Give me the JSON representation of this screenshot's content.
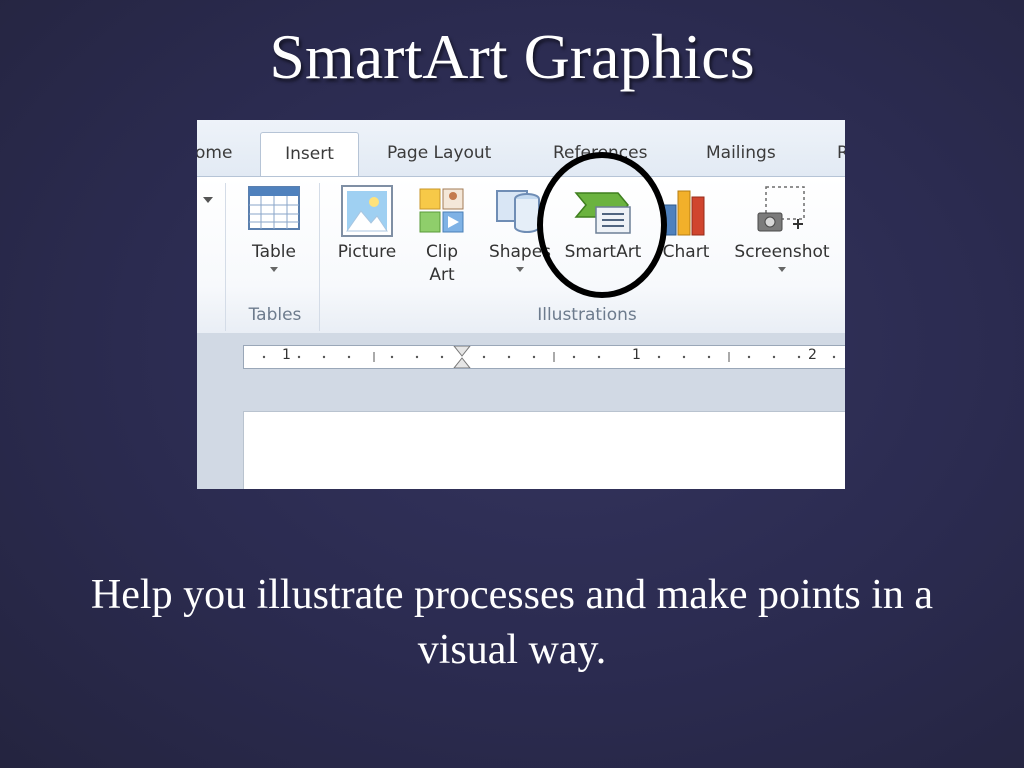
{
  "slide": {
    "title": "SmartArt Graphics",
    "body": "Help you illustrate processes and make points in a visual way."
  },
  "ribbon": {
    "tabs": {
      "home_partial": "ome",
      "insert": "Insert",
      "page_layout": "Page Layout",
      "references": "References",
      "mailings": "Mailings",
      "next_partial": "R"
    },
    "active_tab": "Insert",
    "buttons": {
      "table": "Table",
      "picture": "Picture",
      "clip_art_line1": "Clip",
      "clip_art_line2": "Art",
      "shapes": "Shapes",
      "smartart": "SmartArt",
      "chart": "Chart",
      "screenshot": "Screenshot"
    },
    "groups": {
      "tables": "Tables",
      "illustrations": "Illustrations"
    },
    "highlighted_button": "SmartArt"
  },
  "ruler": {
    "numbers": [
      "1",
      "1",
      "2"
    ]
  },
  "colors": {
    "slide_background": "#2c2c52",
    "title_text": "#ffffff",
    "highlight_circle": "#000000",
    "smartart_icon": "#6bb33f"
  }
}
